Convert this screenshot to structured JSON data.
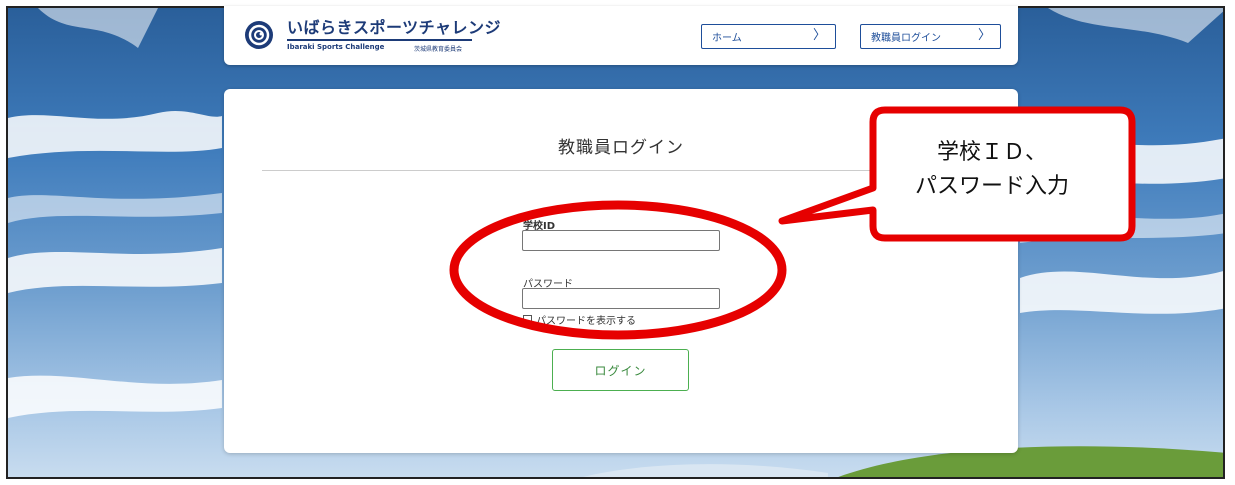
{
  "header": {
    "logo_title": "いばらきスポーツチャレンジ",
    "logo_subtitle": "Ibaraki Sports Challenge",
    "logo_org": "茨城県教育委員会",
    "nav": [
      {
        "label": "ホーム",
        "icon": "chevron-right-icon"
      },
      {
        "label": "教職員ログイン",
        "icon": "chevron-right-icon"
      }
    ]
  },
  "login": {
    "title": "教職員ログイン",
    "school_id_label": "学校ID",
    "school_id_value": "",
    "password_label": "パスワード",
    "password_value": "",
    "show_password_label": "パスワードを表示する",
    "show_password_checked": false,
    "submit_label": "ログイン"
  },
  "annotation": {
    "callout_line1": "学校ＩＤ、",
    "callout_line2": "パスワード入力",
    "highlight_color": "#e60000"
  },
  "colors": {
    "brand": "#1d3b78",
    "nav_border": "#1e4e9a",
    "login_button": "#4caf50"
  }
}
